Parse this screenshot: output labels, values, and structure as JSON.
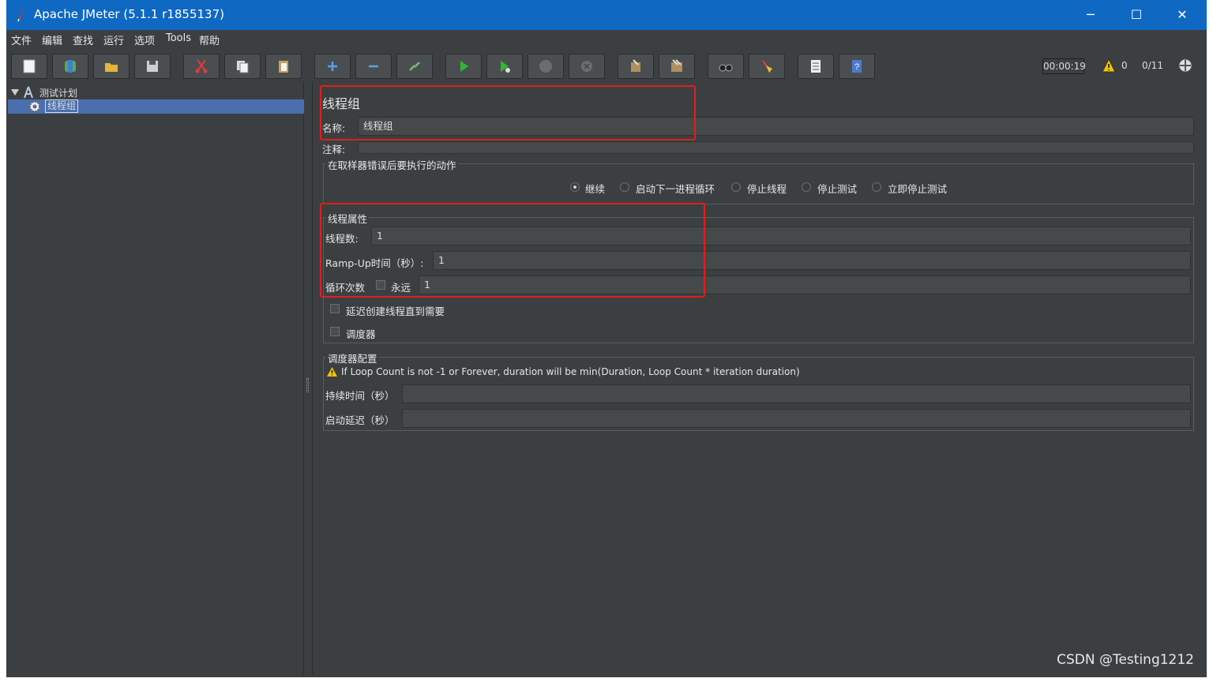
{
  "window": {
    "title": "Apache JMeter (5.1.1 r1855137)",
    "minimize": "─",
    "maximize": "☐",
    "close": "✕"
  },
  "menu": [
    "文件",
    "编辑",
    "查找",
    "运行",
    "选项",
    "Tools",
    "帮助"
  ],
  "toolbar": {
    "timer": "00:00:19",
    "warning_count": "0",
    "threads": "0/11"
  },
  "tree": {
    "root": "测试计划",
    "child": "线程组"
  },
  "panel": {
    "title": "线程组",
    "name_label": "名称:",
    "name_value": "线程组",
    "comment_label": "注释:",
    "sampler_error_title": "在取样器错误后要执行的动作",
    "actions": [
      "继续",
      "启动下一进程循环",
      "停止线程",
      "停止测试",
      "立即停止测试"
    ],
    "thread_props_title": "线程属性",
    "threads_label": "线程数:",
    "threads_value": "1",
    "rampup_label": "Ramp-Up时间（秒）:",
    "rampup_value": "1",
    "loop_label": "循环次数",
    "forever_label": "永远",
    "loop_value": "1",
    "delay_label": "延迟创建线程直到需要",
    "scheduler_label": "调度器",
    "scheduler_config_title": "调度器配置",
    "scheduler_warning": "If Loop Count is not -1 or Forever, duration will be min(Duration, Loop Count * iteration duration)",
    "duration_label": "持续时间（秒）",
    "startup_delay_label": "启动延迟（秒）"
  },
  "watermark": "CSDN @Testing1212",
  "colors": {
    "titlebar": "#0f68c2",
    "background": "#3c3f41",
    "selection": "#4b6eaf",
    "highlight_box": "#e0201a"
  }
}
